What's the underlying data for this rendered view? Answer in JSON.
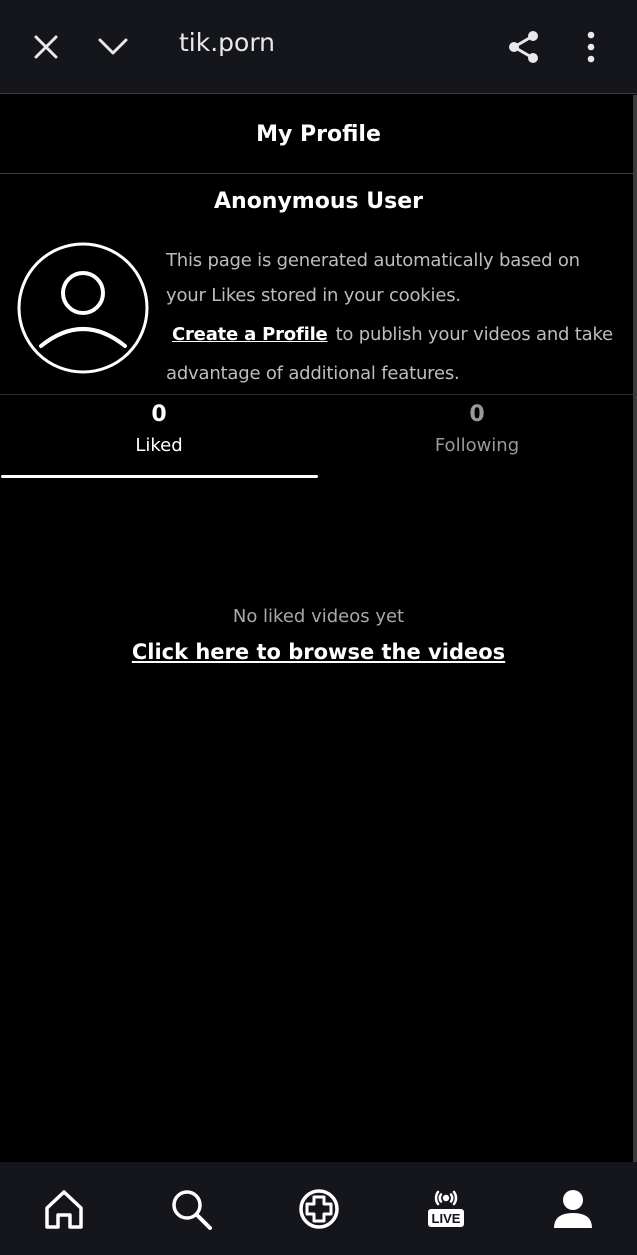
{
  "browser": {
    "url": "tik.porn",
    "icons": [
      "close-icon",
      "chevron-down-icon",
      "share-icon",
      "more-vertical-icon"
    ]
  },
  "header": {
    "title": "My Profile"
  },
  "profile": {
    "name": "Anonymous User",
    "avatar_icon": "user-avatar-icon",
    "description_line1": "This page is generated automatically based on",
    "description_line2": "your Likes stored in your cookies.",
    "create_link": "Create a Profile",
    "description_after": "to publish your videos and take",
    "description_line4": "advantage of additional features."
  },
  "tabs": [
    {
      "count": "0",
      "label": "Liked",
      "active": true
    },
    {
      "count": "0",
      "label": "Following",
      "active": false
    }
  ],
  "empty_state": {
    "message": "No liked videos yet",
    "link": "Click here to browse the videos"
  },
  "bottom_nav": {
    "items": [
      "home-icon",
      "search-icon",
      "add-icon",
      "live-icon",
      "profile-icon"
    ],
    "live_label": "LIVE"
  },
  "colors": {
    "bar_background": "#15161b",
    "page_background": "#000000",
    "active_text": "#ffffff",
    "inactive_text": "#9a9a9a"
  }
}
